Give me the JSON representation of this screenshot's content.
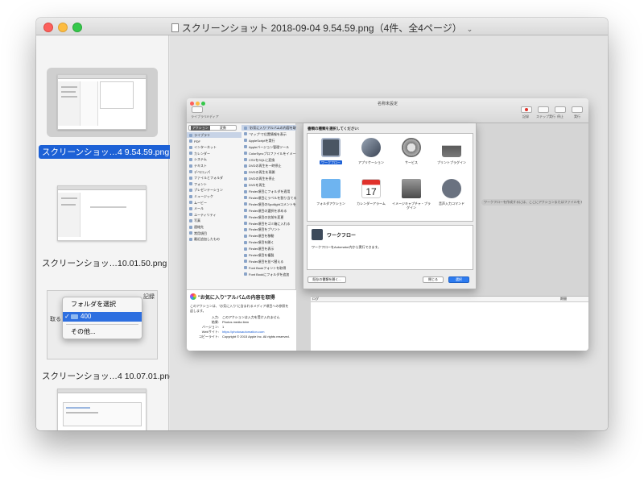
{
  "window": {
    "title": "スクリーンショット 2018-09-04 9.54.59.png（4件、全4ページ）"
  },
  "sidebar": {
    "thumbnails": [
      {
        "label": "スクリーンショッ…4 9.54.59.png",
        "selected": true
      },
      {
        "label": "スクリーンショッ…10.01.50.png",
        "selected": false
      },
      {
        "label": "スクリーンショッ…4 10.07.01.png",
        "selected": false
      },
      {
        "label": "",
        "selected": false
      }
    ],
    "popup_thumb": {
      "menu_items": [
        "フォルダを選択",
        "400",
        "その他..."
      ],
      "checked_item": "✓",
      "side_label": "取る",
      "top_label": "記録"
    }
  },
  "screenshot": {
    "title": "名称未設定",
    "toolbar": {
      "library": "ライブラリ",
      "media": "メディア",
      "record": "記録",
      "step": "ステップ実行",
      "stop": "停止",
      "run": "実行"
    },
    "segments": [
      "アクション",
      "変数"
    ],
    "search_placeholder": "名前",
    "library_items": [
      "ライブラリ",
      "PDF",
      "インターネット",
      "カレンダー",
      "システム",
      "テキスト",
      "デベロッパ",
      "ファイルとフォルダ",
      "フォント",
      "プレゼンテーション",
      "ミュージック",
      "ムービー",
      "メール",
      "ユーティリティ",
      "写真",
      "連絡先",
      "常用項目",
      "最近追加したもの"
    ],
    "action_items": [
      "\"お気に入り\"アルバムの内容を取得",
      "\"マップ\"で位置情報を表示",
      "AppleScriptを実行",
      "Appleバージョン管理ツール",
      "ColorSyncプロファイルをイメージに",
      "CSVをSQLに変換",
      "DVDの再生を一時停止",
      "DVDの再生を再開",
      "DVDの再生を停止",
      "DVDを再生",
      "Finder項目にフォルダを適用",
      "Finder項目にラベルを割り当てる",
      "Finder項目のSpotlightコメントを",
      "Finder項目の選択を求める",
      "Finder項目の名前を変更",
      "Finder項目をゴミ箱に入れる",
      "Finder項目をプリント",
      "Finder項目を移動",
      "Finder項目を開く",
      "Finder項目を表示",
      "Finder項目を複製",
      "Finder項目を並べ替える",
      "Font Bookフォントを取得",
      "Font Bookにフォルダを追加"
    ],
    "description": {
      "heading": "\"お気に入り\"アルバムの内容を取得",
      "body1": "このアクションは、\"お気に入り\"に含まれるメディア項目への参照を",
      "body2": "返します。",
      "input_key": "入力:",
      "input_val": "このアクションは入力を受け入れません",
      "result_key": "結果:",
      "result_val": "Photos media item",
      "version_key": "バージョン:",
      "version_val": "1",
      "web_key": "Webサイト:",
      "web_val": "https://photosautomation.com",
      "copyright_key": "コピーライト:",
      "copyright_val": "Copyright © 2015 Apple Inc. All rights reserved."
    },
    "drop_hint": "ワークフローを作成するには、ここにアクションまたはファイルをドラッグしてください。",
    "log_headers": [
      "ログ",
      "期間"
    ],
    "sheet": {
      "question": "書類の種類を選択してください:",
      "tiles": [
        "ワークフロー",
        "アプリケーション",
        "サービス",
        "プリントプラグイン",
        "フォルダアクション",
        "カレンダーアラーム",
        "イメージキャプチャ・プラグイン",
        "音声入力コマンド"
      ],
      "selected_tile": "ワークフロー",
      "calendar_day": "17",
      "info_title": "ワークフロー",
      "info_body": "ワークフローをAutomator内から実行できます。",
      "open_existing": "既存の書類を開く...",
      "close": "閉じる",
      "choose": "選択"
    }
  },
  "colors": {
    "accent": "#1d61d6",
    "close": "#fc605c",
    "minimize": "#fdbc40",
    "maximize": "#34c84a"
  }
}
